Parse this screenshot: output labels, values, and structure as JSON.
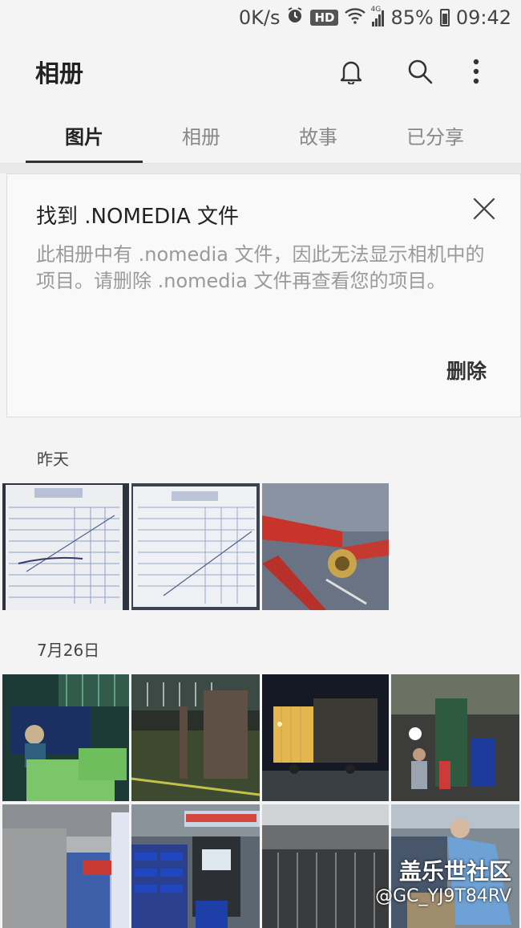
{
  "status_bar": {
    "speed": "0K/s",
    "hd_badge": "HD",
    "network": "4G",
    "battery": "85%",
    "time": "09:42"
  },
  "app_bar": {
    "title": "相册",
    "icons": [
      "bell-icon",
      "search-icon",
      "more-vert-icon"
    ]
  },
  "tabs": [
    {
      "label": "图片",
      "active": true
    },
    {
      "label": "相册",
      "active": false
    },
    {
      "label": "故事",
      "active": false
    },
    {
      "label": "已分享",
      "active": false
    }
  ],
  "notice": {
    "title": "找到 .NOMEDIA 文件",
    "body": "此相册中有 .nomedia 文件，因此无法显示相机中的项目。请删除 .nomedia 文件再查看您的项目。",
    "action": "删除"
  },
  "sections": [
    {
      "label": "昨天",
      "photo_count": 3
    },
    {
      "label": "7月26日",
      "photo_count": 8
    }
  ],
  "watermark": {
    "line1": "盖乐世社区",
    "line2": "@GC_YJ9T84RV"
  }
}
